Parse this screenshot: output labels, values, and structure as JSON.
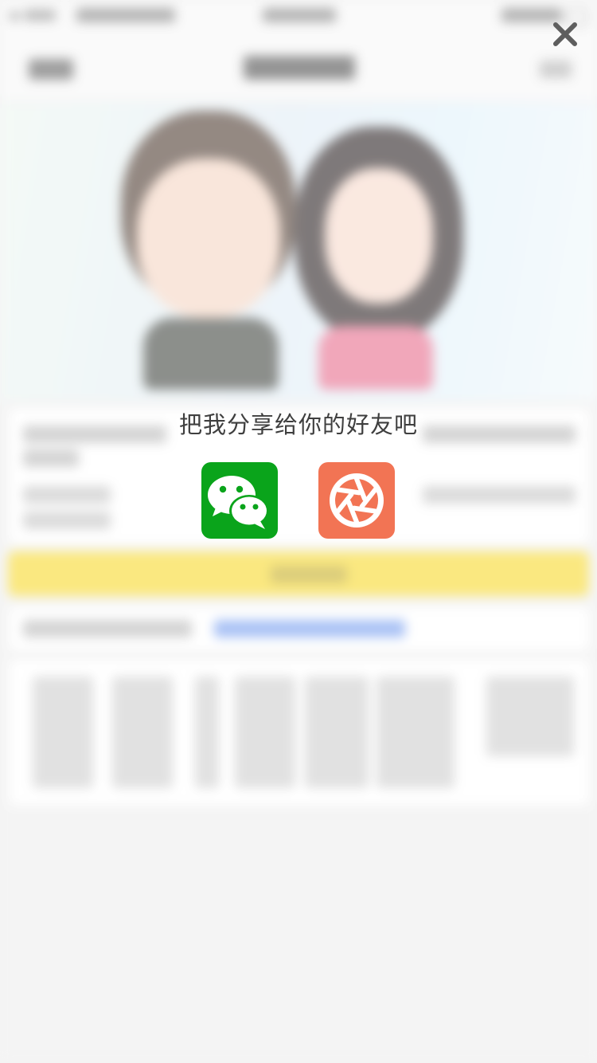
{
  "share_dialog": {
    "title": "把我分享给你的好友吧",
    "close_icon": "close-icon",
    "options": [
      {
        "id": "wechat",
        "icon": "wechat-icon",
        "color": "#0aa41b"
      },
      {
        "id": "moments",
        "icon": "moments-aperture-icon",
        "color": "#f27454"
      }
    ]
  },
  "colors": {
    "accent_yellow": "#f8dc3c",
    "link_blue": "#4d7df0",
    "page_background": "#efefef"
  }
}
